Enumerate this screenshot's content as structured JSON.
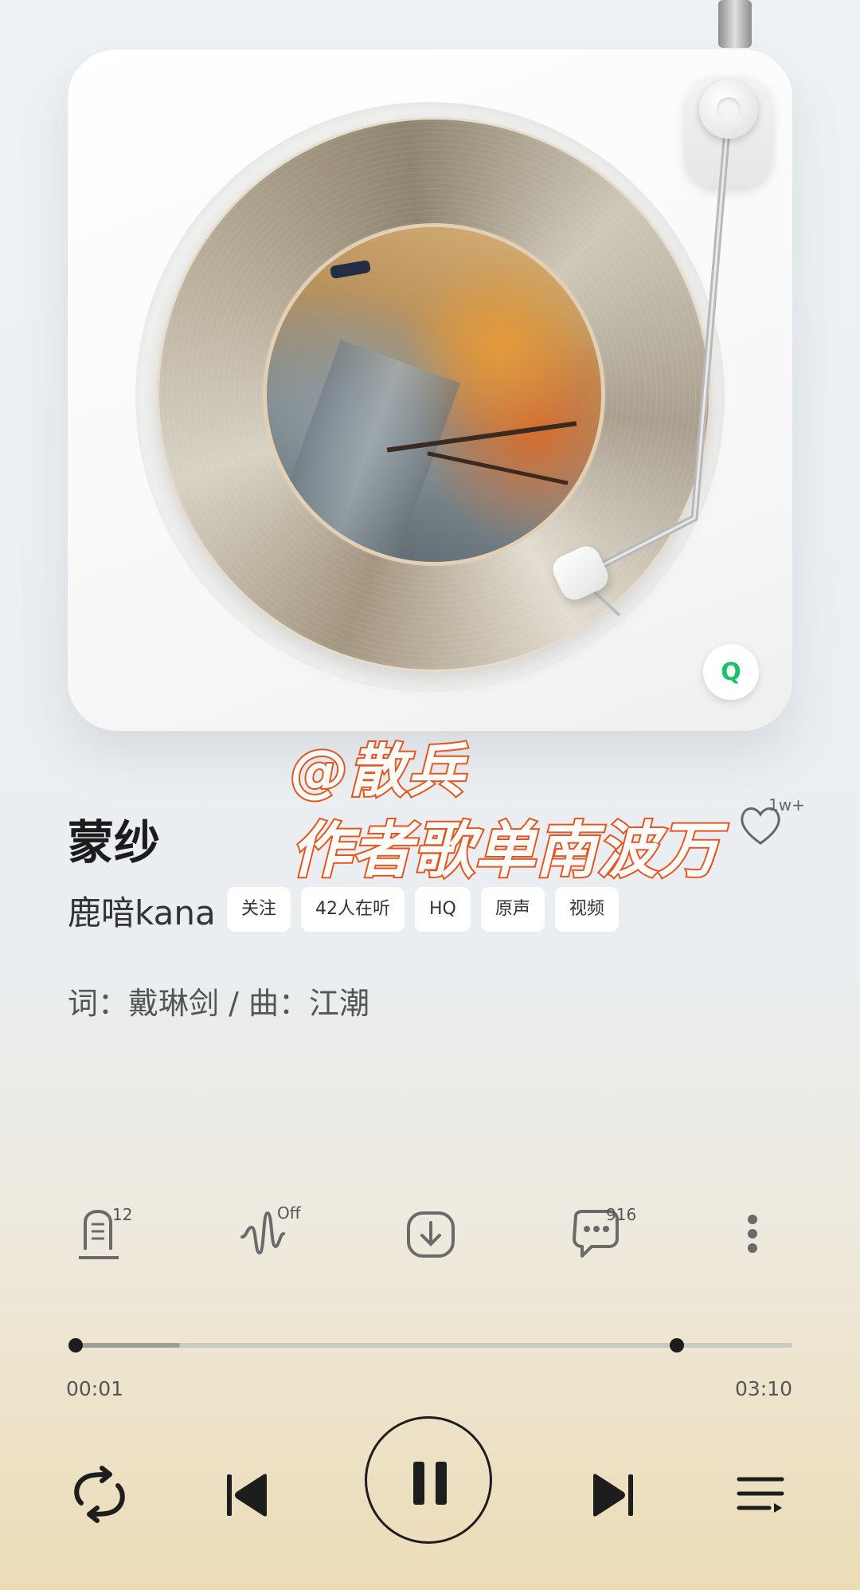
{
  "song": {
    "title": "蒙纱",
    "artist": "鹿喑kana",
    "credits": "词：戴琳剑 / 曲：江潮",
    "favorite_count": "1w+"
  },
  "tags": [
    "关注",
    "42人在听",
    "HQ",
    "原声",
    "视频"
  ],
  "watermark": {
    "line1": "@散兵",
    "line2": "作者歌单南波万"
  },
  "badge": {
    "label": "Q",
    "color": "#1bc06b"
  },
  "actions": {
    "lyrics_count": "12",
    "effect_state": "Off",
    "comment_count": "916"
  },
  "progress": {
    "current": "00:01",
    "total": "03:10",
    "played_fraction": 0.005,
    "buffered_fraction": 0.12
  },
  "icons": {
    "loop": "loop-icon",
    "prev": "previous-icon",
    "play_pause": "pause-icon",
    "next": "next-icon",
    "playlist": "playlist-icon"
  }
}
